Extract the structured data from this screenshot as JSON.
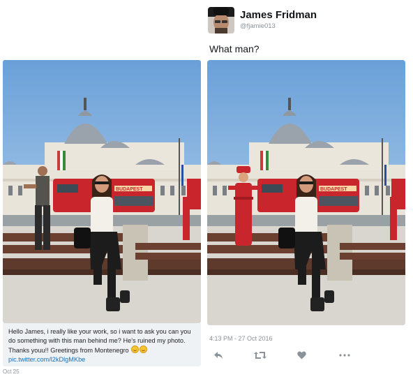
{
  "author": {
    "name": "James Fridman",
    "handle": "@fjamie013"
  },
  "tweet": {
    "text": "What man?",
    "timestamp": "4:13 PM - 27 Oct 2016"
  },
  "original_tweet": {
    "text": "Hello James, i really like your work, so i want to ask you can you do something with this man behind me? He's ruined my photo. Thanks youu!! Greetings from Montenegro",
    "link": "pic.twitter.com/l2kDlgMKbe",
    "date": "Oct 25"
  },
  "photo_sign": "BUDAPEST",
  "colors": {
    "sky_top": "#6aa0d8",
    "sky_bottom": "#c4dcf1",
    "link": "#1b6fb5",
    "muted": "#8a9399",
    "bus_red": "#c8262c",
    "bench_brown": "#6b4030"
  },
  "icons": [
    "reply-icon",
    "retweet-icon",
    "like-icon",
    "more-icon",
    "emoji-icon"
  ]
}
